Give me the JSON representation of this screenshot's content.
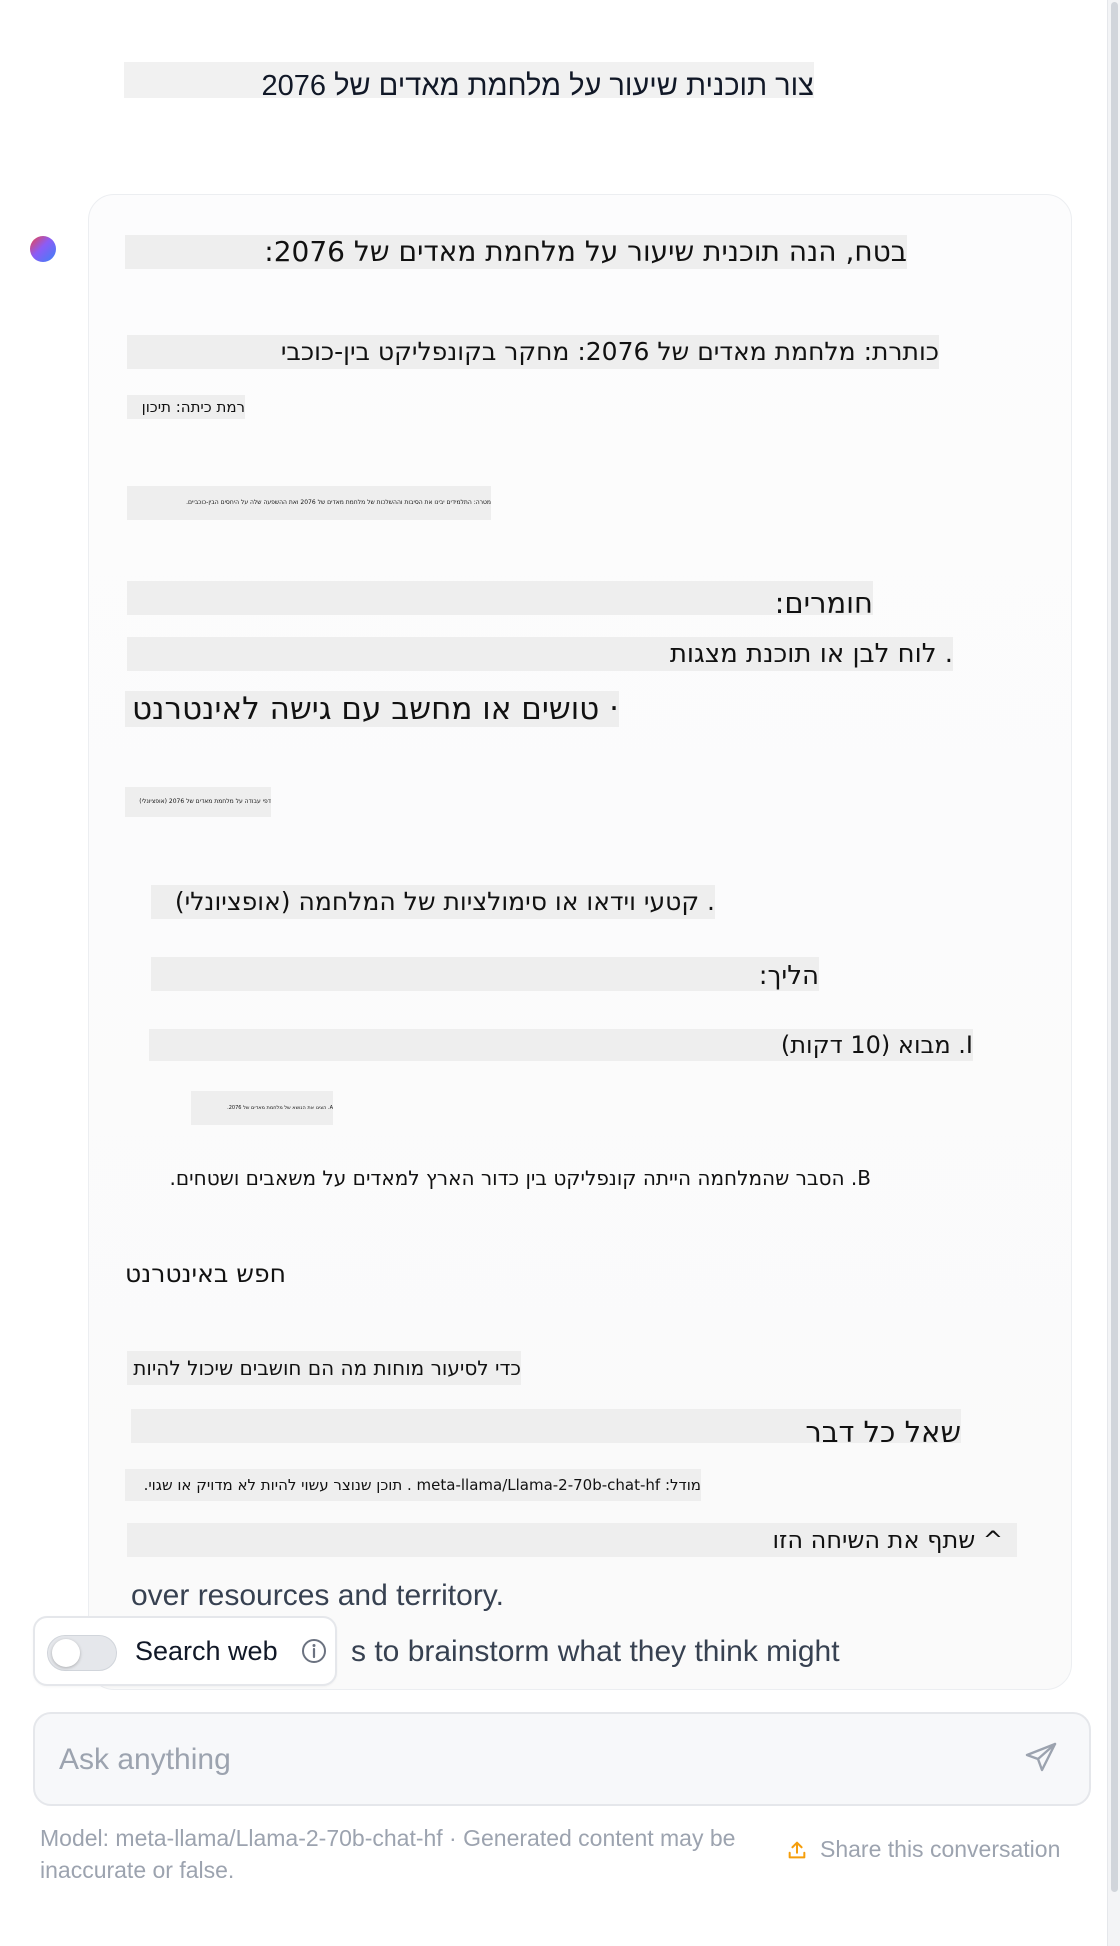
{
  "conversation": {
    "user_message": "צור תוכנית שיעור על מלחמת מאדים של 2076",
    "assistant": {
      "intro": "בטח, הנה תוכנית שיעור על מלחמת מאדים של 2076:",
      "title_line": "כותרת: מלחמת מאדים של 2076: מחקר בקונפליקט בין-כוכבי",
      "grade_level": "רמת כיתה: תיכון",
      "objective_tiny": "מטרה: התלמידים יבינו את הסיבות וההשלכות של מלחמת מאדים של 2076 ואת ההשפעה שלה על היחסים הבין-כוכביים.",
      "materials_heading": "חומרים:",
      "materials_whiteboard": ". לוח לבן או תוכנת מצגות",
      "materials_computer": "· טושים או מחשב עם גישה לאינטרנט",
      "materials_tiny": "דפי עבודה על מלחמת מאדים של 2076 (אופציונלי)",
      "materials_video": ". קטעי וידאו או סימולציות של המלחמה (אופציונלי)",
      "procedure_heading": "הליך:",
      "intro_section": "I. מבוא (10 דקות)",
      "intro_a_tiny": "A. הציגו את הנושא של מלחמת מאדים של 2076.",
      "intro_b": "B. הסבר שהמלחמה הייתה קונפליקט בין כדור הארץ למאדים על משאבים ושטחים.",
      "search_web_he": "חפש באינטרנט",
      "brainstorm_he": "כדי לסיעור מוחות מה הם חושבים שיכול להיות",
      "ask_anything_he": "שאל כל דבר",
      "model_notice_he": "מודל: meta-llama/Llama-2-70b-chat-hf . תוכן שנוצר עשוי להיות לא מדויק או שגוי.",
      "share_he": "^ שתף את השיחה הזו",
      "en_line_1": "over resources and territory.",
      "en_line_2": "s to brainstorm what they think might"
    }
  },
  "search_toggle": {
    "label": "Search web",
    "enabled": false
  },
  "composer": {
    "placeholder": "Ask anything",
    "value": ""
  },
  "footer": {
    "model_notice": "Model: meta-llama/Llama-2-70b-chat-hf · Generated content may be inaccurate or false.",
    "share_label": "Share this conversation"
  },
  "icons": {
    "avatar": "assistant-avatar",
    "info": "info-icon",
    "send": "send-icon",
    "share": "share-icon"
  },
  "colors": {
    "accent_share_icon": "#f59e0b",
    "muted_text": "#9ca3af",
    "avatar_gradient": [
      "#ef4444",
      "#8b5cf6",
      "#3b82f6"
    ]
  }
}
